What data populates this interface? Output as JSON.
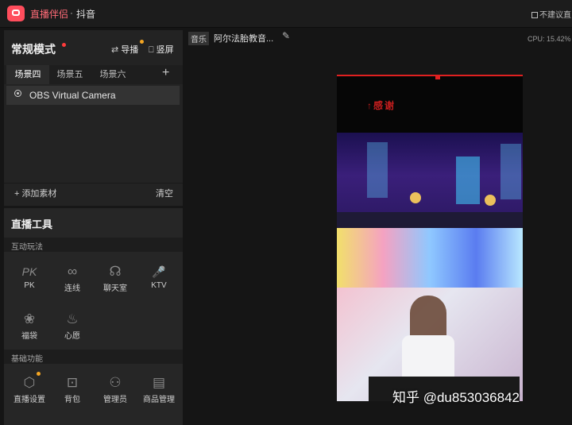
{
  "titlebar": {
    "app_name": "直播伴侣",
    "separator": "·",
    "platform": "抖音",
    "volume_warning": "不建议直"
  },
  "mode": {
    "label": "常规模式",
    "guide_label": "导播",
    "landscape_label": "竖屏"
  },
  "scene_tabs": [
    {
      "label": "场景四",
      "active": true
    },
    {
      "label": "场景五",
      "active": false
    },
    {
      "label": "场景六",
      "active": false
    }
  ],
  "add_tab_glyph": "+",
  "sources": [
    {
      "label": "OBS Virtual Camera",
      "icon": "camera-icon"
    }
  ],
  "source_footer": {
    "add_label": "添加素材",
    "clear_label": "清空"
  },
  "tools": {
    "title": "直播工具",
    "interact_header": "互动玩法",
    "interact_items": [
      {
        "label": "PK",
        "glyph": "PK",
        "icon": "pk-icon"
      },
      {
        "label": "连线",
        "glyph": "∞",
        "icon": "link-icon"
      },
      {
        "label": "聊天室",
        "glyph": "☊",
        "icon": "chatroom-icon"
      },
      {
        "label": "KTV",
        "glyph": "🎤",
        "icon": "mic-icon"
      },
      {
        "label": "福袋",
        "glyph": "❀",
        "icon": "lucky-bag-icon"
      },
      {
        "label": "心愿",
        "glyph": "♨",
        "icon": "wish-icon"
      }
    ],
    "basic_header": "基础功能",
    "basic_items": [
      {
        "label": "直播设置",
        "glyph": "⬡",
        "icon": "settings-icon",
        "dot": true
      },
      {
        "label": "背包",
        "glyph": "⊡",
        "icon": "backpack-icon",
        "dot": false
      },
      {
        "label": "管理员",
        "glyph": "⚇",
        "icon": "admin-icon",
        "dot": false
      },
      {
        "label": "商品管理",
        "glyph": "▤",
        "icon": "goods-icon",
        "dot": false
      }
    ]
  },
  "music": {
    "tag": "音乐",
    "title": "阿尔法胎教音..."
  },
  "cpu_text": "CPU: 15.42%",
  "preview": {
    "overlay_text": "↑感谢"
  },
  "watermark": "知乎 @du853036842",
  "colors": {
    "accent": "#ff4d5c",
    "badge_dot": "#f5a623",
    "alert_dot": "#ff3b3b"
  }
}
